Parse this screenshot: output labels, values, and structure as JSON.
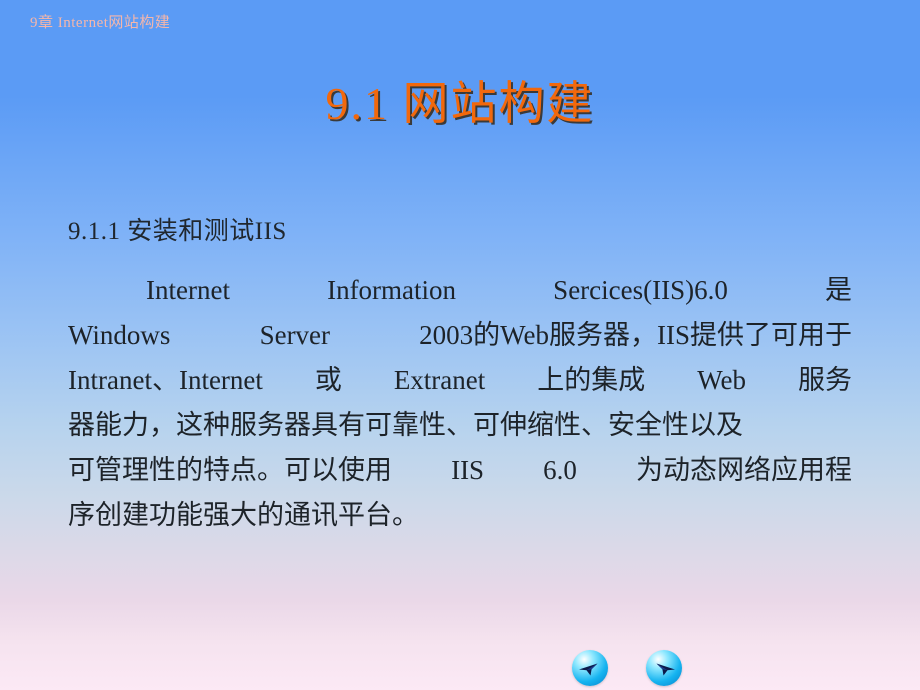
{
  "slide": {
    "header_label": "9章 Internet网站构建",
    "title": "9.1  网站构建",
    "section_heading": "9.1.1 安装和测试IIS",
    "body_lines": [
      {
        "segments": [
          "Internet",
          "Information",
          "Sercices(IIS)6.0",
          "是"
        ]
      },
      {
        "segments": [
          "Windows",
          "Server",
          "2003的Web服务器，IIS提供了可用于"
        ]
      },
      {
        "segments": [
          "Intranet、Internet",
          "或",
          "Extranet",
          "上的集成",
          "Web",
          "服务"
        ]
      },
      {
        "segments": [
          "器能力，这种服务器具有可靠性、可伸缩性、安全性以及"
        ]
      },
      {
        "segments": [
          "可管理性的特点。可以使用",
          "IIS",
          "6.0",
          "为动态网络应用程"
        ]
      },
      {
        "segments": [
          "序创建功能强大的通讯平台。"
        ]
      }
    ],
    "nav": {
      "prev_label": "上一页",
      "next_label": "下一页"
    },
    "colors": {
      "background_top": "#5b9bf5",
      "background_bottom": "#fce9f5",
      "header_text": "#f4b6ab",
      "title_text": "#f2680c",
      "title_shadow": "#3a3a3a",
      "body_text": "#1d2329",
      "nav_button": "#16b4f0",
      "nav_arrow": "#0b1a4a"
    }
  }
}
